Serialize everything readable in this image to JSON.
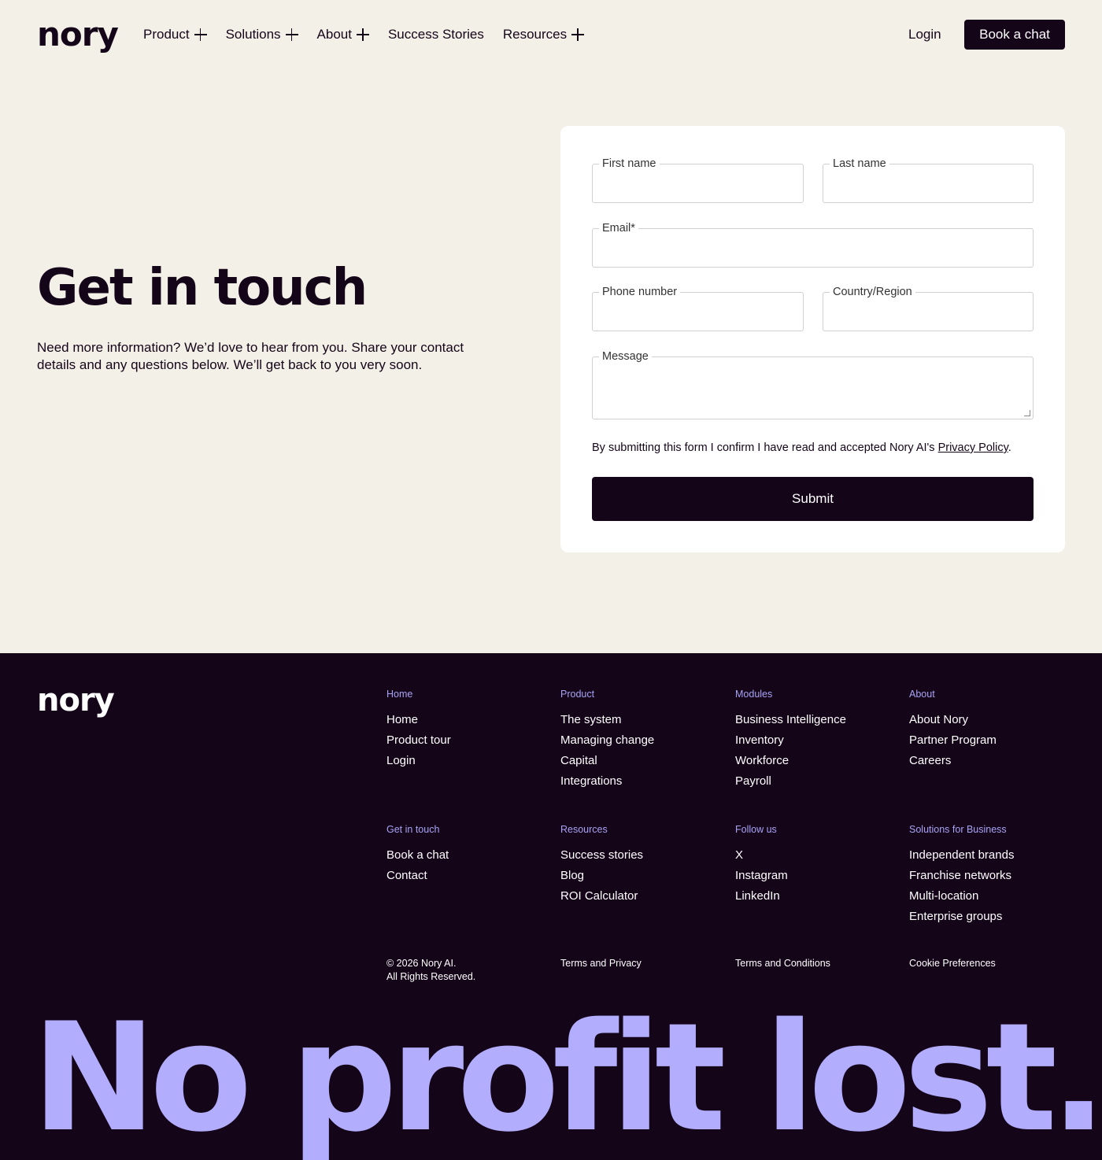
{
  "header": {
    "logo": "nory",
    "nav": [
      {
        "label": "Product",
        "has_plus": true
      },
      {
        "label": "Solutions",
        "has_plus": true
      },
      {
        "label": "About",
        "has_plus": true
      },
      {
        "label": "Success Stories",
        "has_plus": false
      },
      {
        "label": "Resources",
        "has_plus": true
      }
    ],
    "login": "Login",
    "cta": "Book a chat"
  },
  "hero": {
    "title": "Get in touch",
    "text": "Need more information? We’d love to hear from you. Share your contact details and any questions below. We’ll get back to you very soon."
  },
  "form": {
    "first_name": "First name",
    "last_name": "Last name",
    "email": "Email*",
    "phone": "Phone number",
    "country": "Country/Region",
    "message": "Message",
    "consent_prefix": "By submitting this form I confirm I have read and accepted Nory AI's ",
    "consent_link": "Privacy Policy",
    "consent_suffix": ".",
    "submit": "Submit"
  },
  "footer": {
    "logo": "nory",
    "columns": [
      {
        "heading": "Home",
        "items": [
          "Home",
          "Product tour",
          "Login"
        ]
      },
      {
        "heading": "Product",
        "items": [
          "The system",
          "Managing change",
          "Capital",
          "Integrations"
        ]
      },
      {
        "heading": "Modules",
        "items": [
          "Business Intelligence",
          "Inventory",
          "Workforce",
          "Payroll"
        ]
      },
      {
        "heading": "About",
        "items": [
          "About Nory",
          "Partner Program",
          "Careers"
        ]
      },
      {
        "heading": "Get in touch",
        "items": [
          "Book a chat",
          "Contact"
        ]
      },
      {
        "heading": "Resources",
        "items": [
          "Success stories",
          "Blog",
          "ROI Calculator"
        ]
      },
      {
        "heading": "Follow us",
        "items": [
          "X",
          "Instagram",
          "LinkedIn"
        ]
      },
      {
        "heading": "Solutions for Business",
        "items": [
          "Independent brands",
          "Franchise networks",
          "Multi-location",
          "Enterprise groups"
        ]
      }
    ],
    "copyright_line1": "© 2026 Nory AI.",
    "copyright_line2": "All Rights Reserved.",
    "terms_privacy": "Terms and Privacy",
    "terms_conditions": "Terms and Conditions",
    "cookie_prefs": "Cookie Preferences",
    "slogan": "No profit lost."
  }
}
